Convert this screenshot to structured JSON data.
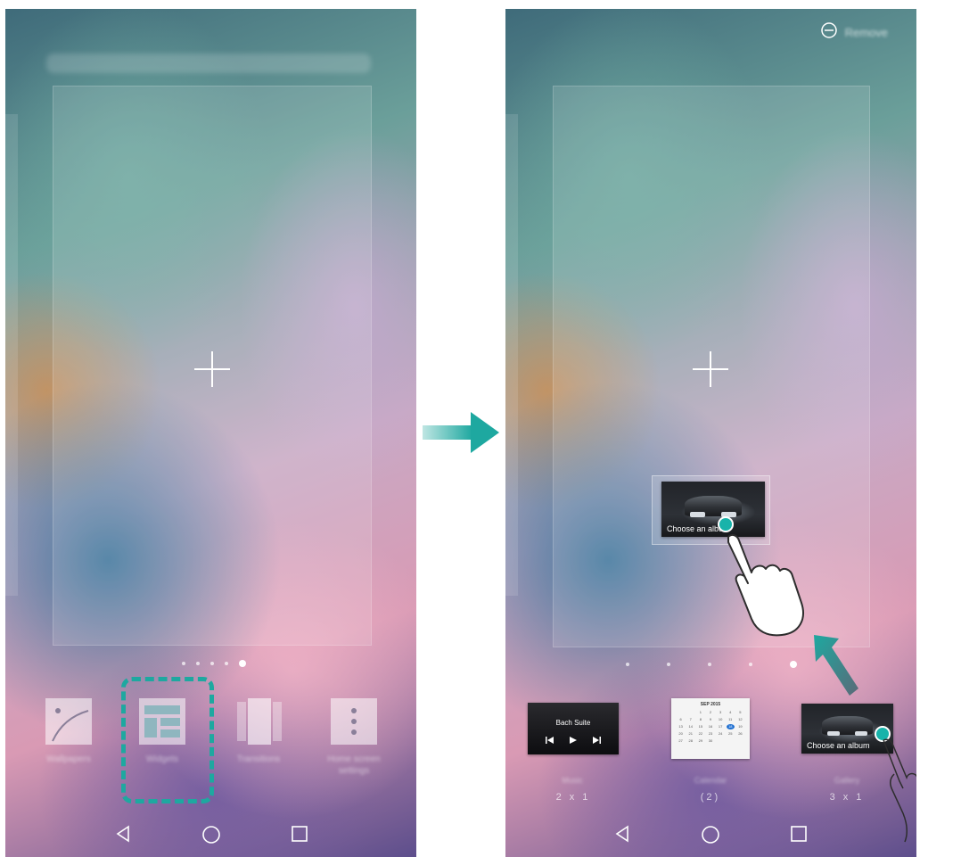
{
  "left_screen": {
    "menu": [
      {
        "id": "wallpapers",
        "label": "Wallpapers"
      },
      {
        "id": "widgets",
        "label": "Widgets"
      },
      {
        "id": "transitions",
        "label": "Transitions"
      },
      {
        "id": "settings",
        "label": "Home screen settings"
      }
    ],
    "page_indicator": {
      "count": 5,
      "active_index": 4
    }
  },
  "right_screen": {
    "remove_label": "Remove",
    "widgets": [
      {
        "id": "music",
        "title": "Bach Suite",
        "size": "2 x 1",
        "name": "Music"
      },
      {
        "id": "calendar",
        "month": "SEP 2015",
        "size": "(2)",
        "name": "Calendar"
      },
      {
        "id": "gallery",
        "album_label": "Choose an album",
        "size": "3 x 1",
        "name": "Gallery"
      }
    ],
    "dragged_widget_label": "Choose an album",
    "page_indicator": {
      "count": 5,
      "active_index": 4
    }
  },
  "calendar_days": [
    "",
    "",
    "1",
    "2",
    "3",
    "4",
    "5",
    "6",
    "7",
    "8",
    "9",
    "10",
    "11",
    "12",
    "13",
    "14",
    "15",
    "16",
    "17",
    "18",
    "19",
    "20",
    "21",
    "22",
    "23",
    "24",
    "25",
    "26",
    "27",
    "28",
    "29",
    "30",
    "",
    "",
    ""
  ],
  "calendar_today": "18",
  "colors": {
    "accent": "#1ea8a0",
    "touch": "#18b3aa"
  },
  "icons": {
    "back": "back-triangle-icon",
    "home": "home-circle-icon",
    "recent": "recent-square-icon",
    "remove": "minus-circle-icon",
    "add": "plus-icon",
    "flow": "arrow-right-icon"
  }
}
